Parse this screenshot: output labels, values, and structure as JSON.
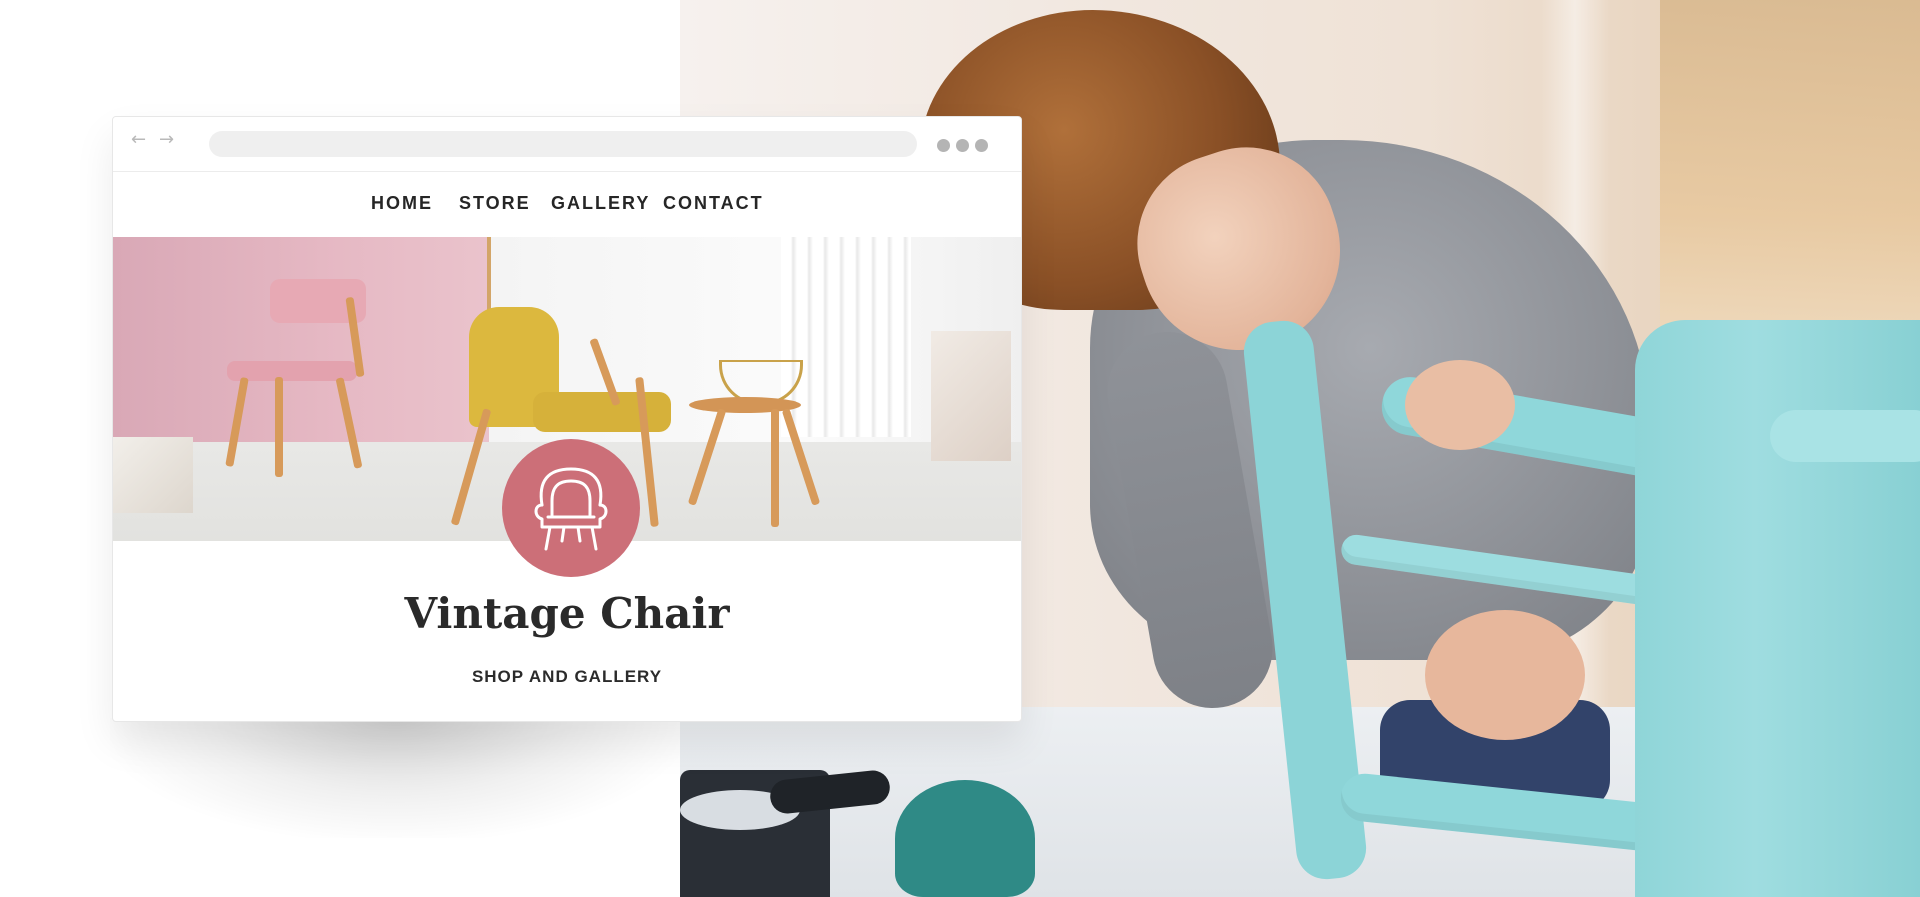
{
  "browser": {
    "back_icon": "arrow-left-icon",
    "forward_icon": "arrow-right-icon",
    "back_glyph": "←",
    "forward_glyph": "→",
    "menu_icon": "more-dots-icon"
  },
  "site": {
    "nav": {
      "home": "HOME",
      "store": "STORE",
      "gallery": "GALLERY",
      "contact": "CONTACT"
    },
    "logo_icon": "armchair-icon",
    "title": "Vintage Chair",
    "subtitle": "SHOP AND GALLERY",
    "accent_color": "#cc6f78"
  }
}
